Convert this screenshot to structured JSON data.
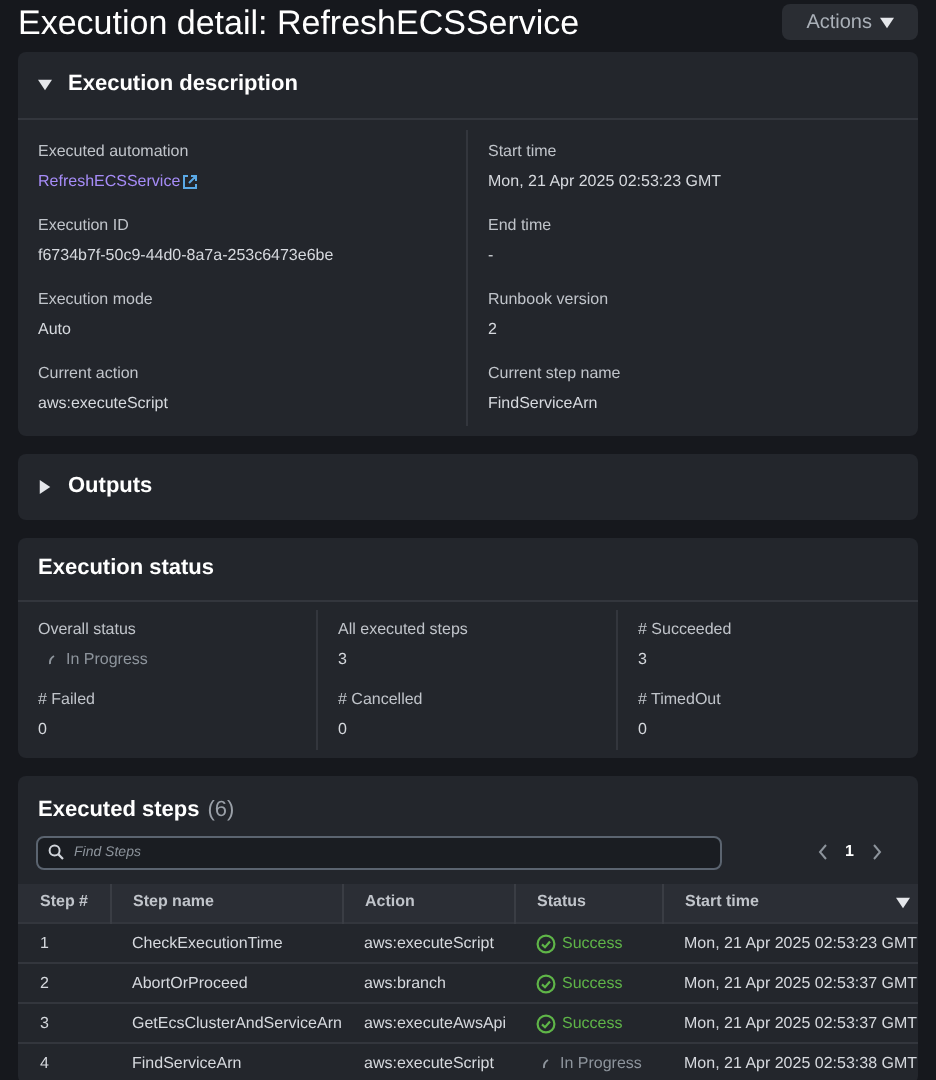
{
  "page": {
    "title": "Execution detail: RefreshECSService",
    "actions_button": "Actions"
  },
  "description": {
    "title": "Execution description",
    "expanded": true,
    "fields": [
      {
        "label": "Executed automation",
        "value": "RefreshECSService",
        "kind": "link"
      },
      {
        "label": "Start time",
        "value": "Mon, 21 Apr 2025 02:53:23 GMT",
        "kind": "text"
      },
      {
        "label": "Execution ID",
        "value": "f6734b7f-50c9-44d0-8a7a-253c6473e6be",
        "kind": "text"
      },
      {
        "label": "End time",
        "value": "-",
        "kind": "text"
      },
      {
        "label": "Execution mode",
        "value": "Auto",
        "kind": "text"
      },
      {
        "label": "Runbook version",
        "value": "2",
        "kind": "text"
      },
      {
        "label": "Current action",
        "value": "aws:executeScript",
        "kind": "text"
      },
      {
        "label": "Current step name",
        "value": "FindServiceArn",
        "kind": "text"
      }
    ]
  },
  "outputs": {
    "title": "Outputs",
    "expanded": false
  },
  "execution_status": {
    "title": "Execution status",
    "fields": [
      {
        "label": "Overall status",
        "value": "In Progress",
        "kind": "in_progress"
      },
      {
        "label": "All executed steps",
        "value": "3",
        "kind": "text"
      },
      {
        "label": "# Succeeded",
        "value": "3",
        "kind": "text"
      },
      {
        "label": "# Failed",
        "value": "0",
        "kind": "text"
      },
      {
        "label": "# Cancelled",
        "value": "0",
        "kind": "text"
      },
      {
        "label": "# TimedOut",
        "value": "0",
        "kind": "text"
      }
    ]
  },
  "executed_steps": {
    "title": "Executed steps",
    "count": "(6)",
    "search": {
      "placeholder": "Find Steps"
    },
    "page": "1",
    "columns": [
      "Step #",
      "Step name",
      "Action",
      "Status",
      "Start time"
    ],
    "rows": [
      {
        "step": "1",
        "name": "CheckExecutionTime",
        "action": "aws:executeScript",
        "status": "Success",
        "kind": "success",
        "start": "Mon, 21 Apr 2025 02:53:23 GMT"
      },
      {
        "step": "2",
        "name": "AbortOrProceed",
        "action": "aws:branch",
        "status": "Success",
        "kind": "success",
        "start": "Mon, 21 Apr 2025 02:53:37 GMT"
      },
      {
        "step": "3",
        "name": "GetEcsClusterAndServiceArn",
        "action": "aws:executeAwsApi",
        "status": "Success",
        "kind": "success",
        "start": "Mon, 21 Apr 2025 02:53:37 GMT"
      },
      {
        "step": "4",
        "name": "FindServiceArn",
        "action": "aws:executeScript",
        "status": "In Progress",
        "kind": "in_progress",
        "start": "Mon, 21 Apr 2025 02:53:38 GMT"
      }
    ]
  }
}
